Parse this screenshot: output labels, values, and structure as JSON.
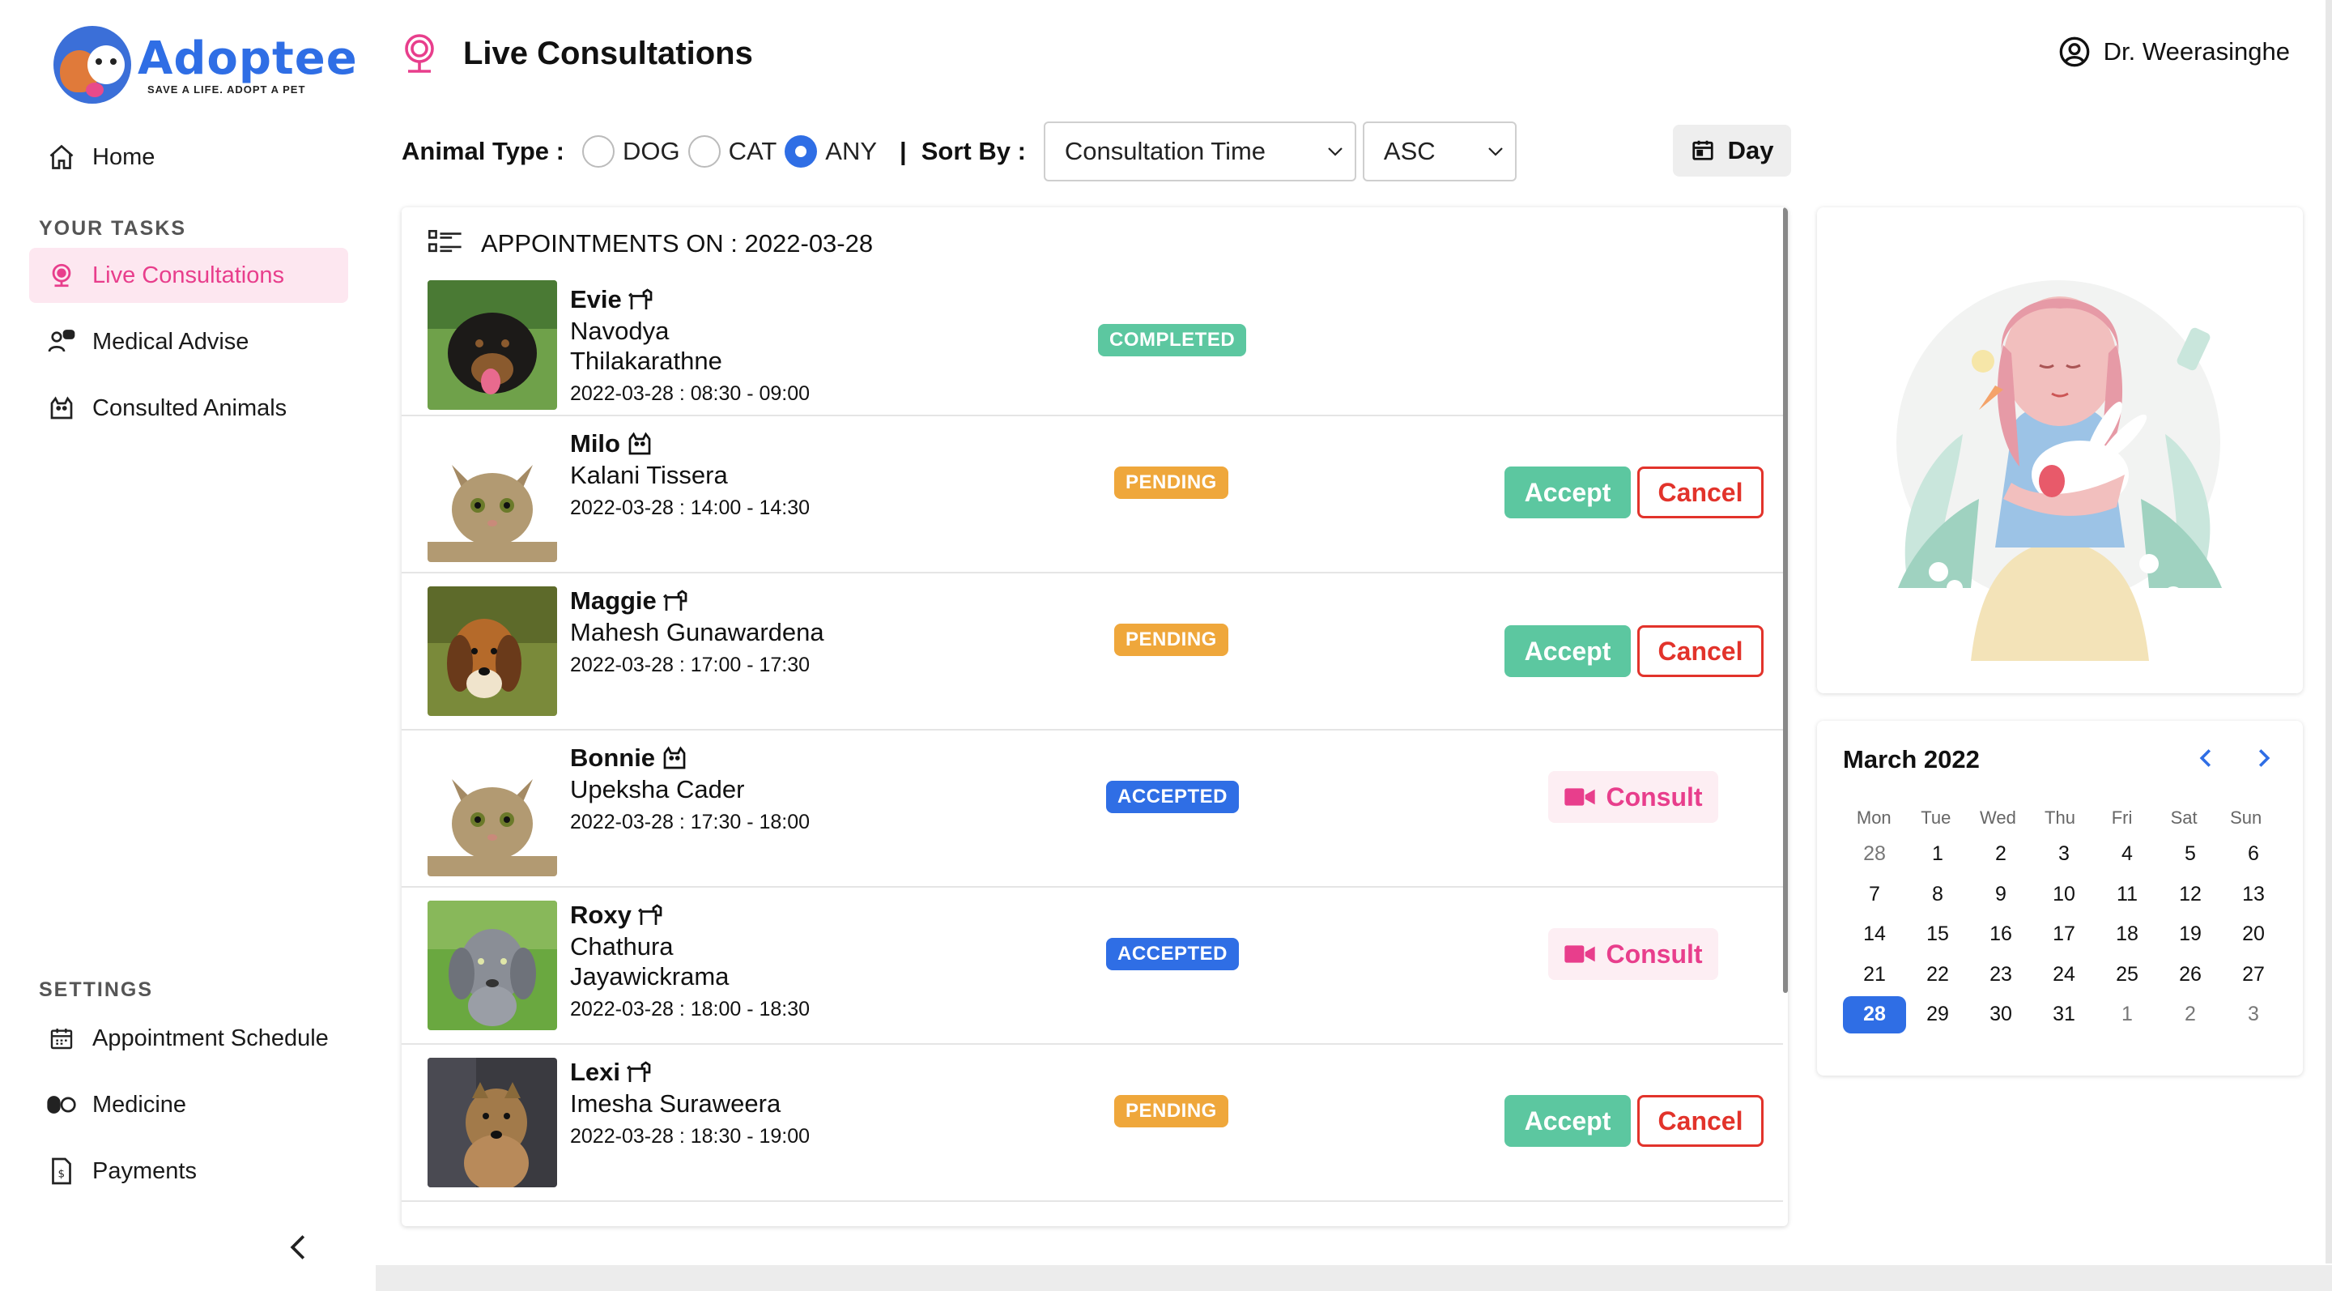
{
  "app": {
    "brand": "Adoptee",
    "tagline": "SAVE A LIFE.  ADOPT A PET"
  },
  "sidebar": {
    "home": "Home",
    "tasks_label": "YOUR TASKS",
    "tasks": [
      {
        "label": "Live Consultations",
        "icon": "webcam-icon"
      },
      {
        "label": "Medical Advise",
        "icon": "people-chat-icon"
      },
      {
        "label": "Consulted Animals",
        "icon": "cat-icon"
      }
    ],
    "settings_label": "SETTINGS",
    "settings": [
      {
        "label": "Appointment Schedule",
        "icon": "calendar-icon"
      },
      {
        "label": "Medicine",
        "icon": "pills-icon"
      },
      {
        "label": "Payments",
        "icon": "invoice-icon"
      }
    ]
  },
  "header": {
    "title": "Live Consultations",
    "user": "Dr. Weerasinghe"
  },
  "filters": {
    "animal_type_label": "Animal Type :",
    "options": [
      "DOG",
      "CAT",
      "ANY"
    ],
    "selected": "ANY",
    "separator": "|",
    "sort_label": "Sort By :",
    "sort_field": "Consultation Time",
    "sort_order": "ASC",
    "view": "Day"
  },
  "appointments": {
    "heading": "APPOINTMENTS ON : 2022-03-28",
    "items": [
      {
        "pet": "Evie",
        "pet_type": "dog",
        "owner_line1": "Navodya",
        "owner_line2": "Thilakarathne",
        "time": "2022-03-28 : 08:30 - 09:00",
        "status": "COMPLETED"
      },
      {
        "pet": "Milo",
        "pet_type": "cat",
        "owner_line1": "Kalani Tissera",
        "owner_line2": "",
        "time": "2022-03-28 : 14:00 - 14:30",
        "status": "PENDING",
        "accept": "Accept",
        "cancel": "Cancel"
      },
      {
        "pet": "Maggie",
        "pet_type": "dog",
        "owner_line1": "Mahesh Gunawardena",
        "owner_line2": "",
        "time": "2022-03-28 : 17:00 - 17:30",
        "status": "PENDING",
        "accept": "Accept",
        "cancel": "Cancel"
      },
      {
        "pet": "Bonnie",
        "pet_type": "cat",
        "owner_line1": "Upeksha Cader",
        "owner_line2": "",
        "time": "2022-03-28 : 17:30 - 18:00",
        "status": "ACCEPTED",
        "consult": "Consult"
      },
      {
        "pet": "Roxy",
        "pet_type": "dog",
        "owner_line1": "Chathura",
        "owner_line2": "Jayawickrama",
        "time": "2022-03-28 : 18:00 - 18:30",
        "status": "ACCEPTED",
        "consult": "Consult"
      },
      {
        "pet": "Lexi",
        "pet_type": "dog",
        "owner_line1": "Imesha Suraweera",
        "owner_line2": "",
        "time": "2022-03-28 : 18:30 - 19:00",
        "status": "PENDING",
        "accept": "Accept",
        "cancel": "Cancel"
      }
    ]
  },
  "calendar": {
    "month": "March 2022",
    "weekdays": [
      "Mon",
      "Tue",
      "Wed",
      "Thu",
      "Fri",
      "Sat",
      "Sun"
    ],
    "weeks": [
      [
        "28",
        "1",
        "2",
        "3",
        "4",
        "5",
        "6"
      ],
      [
        "7",
        "8",
        "9",
        "10",
        "11",
        "12",
        "13"
      ],
      [
        "14",
        "15",
        "16",
        "17",
        "18",
        "19",
        "20"
      ],
      [
        "21",
        "22",
        "23",
        "24",
        "25",
        "26",
        "27"
      ],
      [
        "28",
        "29",
        "30",
        "31",
        "1",
        "2",
        "3"
      ]
    ],
    "selected_day": "28"
  },
  "colors": {
    "accent_pink": "#e83e8c",
    "primary_blue": "#2f6ee5",
    "success_green": "#5cc7a0",
    "pending_orange": "#efa73b",
    "danger_red": "#e2332b"
  }
}
